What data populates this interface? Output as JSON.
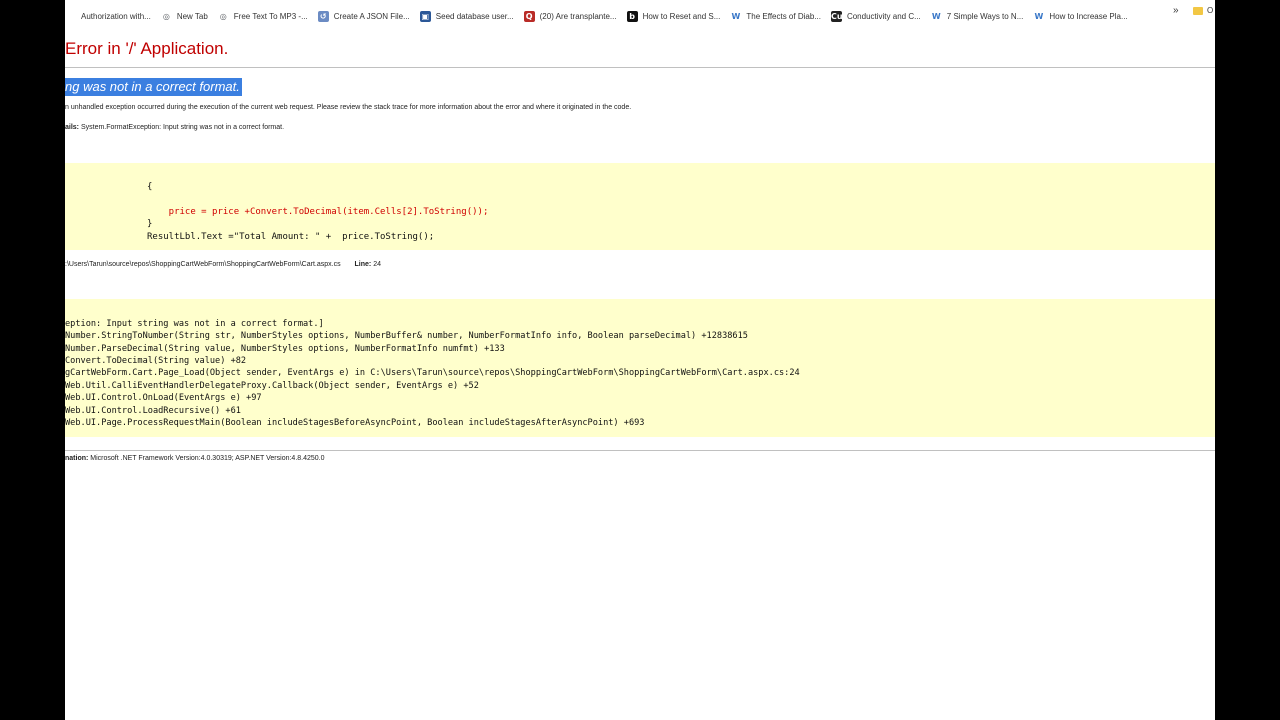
{
  "bookmarks": [
    {
      "label": "Authorization with...",
      "icon": "document-icon",
      "color": "#999999",
      "glyph": ""
    },
    {
      "label": "New Tab",
      "icon": "globe-icon",
      "color": "#5f6368",
      "glyph": "◎"
    },
    {
      "label": "Free Text To MP3 -...",
      "icon": "globe-icon",
      "color": "#5f6368",
      "glyph": "◎"
    },
    {
      "label": "Create A JSON File...",
      "icon": "document-icon",
      "color": "#6b8bc3",
      "glyph": "↺"
    },
    {
      "label": "Seed database user...",
      "icon": "db-icon",
      "color": "#2b5797",
      "glyph": "▣"
    },
    {
      "label": "(20) Are transplante...",
      "icon": "quora-icon",
      "color": "#b92b27",
      "glyph": "Q"
    },
    {
      "label": "How to Reset and S...",
      "icon": "b-logo-icon",
      "color": "#111111",
      "glyph": "b"
    },
    {
      "label": "The Effects of Diab...",
      "icon": "ivy-icon",
      "color": "#3a78c8",
      "glyph": "W"
    },
    {
      "label": "Conductivity and C...",
      "icon": "cu-icon",
      "color": "#222222",
      "glyph": "Cu"
    },
    {
      "label": "7 Simple Ways to N...",
      "icon": "ivy-icon",
      "color": "#3a78c8",
      "glyph": "W"
    },
    {
      "label": "How to Increase Pla...",
      "icon": "ivy-icon",
      "color": "#3a78c8",
      "glyph": "W"
    }
  ],
  "bookmarks_more": "»",
  "bookmarks_folder": "O",
  "error": {
    "title": "Error in '/' Application.",
    "subtitle": "ng was not in a correct format.",
    "description": "n unhandled exception occurred during the execution of the current web request. Please review the stack trace for more information about the error and where it originated in the code.",
    "details_label": "ails:",
    "details_text": "System.FormatException: Input string was not in a correct format."
  },
  "source_code": [
    {
      "text": "{",
      "red": false
    },
    {
      "text": "    price = price +Convert.ToDecimal(item.Cells[2].ToString());",
      "red": true
    },
    {
      "text": "}",
      "red": false
    },
    {
      "text": "ResultLbl.Text =\"Total Amount: \" +  price.ToString();",
      "red": false
    }
  ],
  "source_file": {
    "path": ":\\Users\\Tarun\\source\\repos\\ShoppingCartWebForm\\ShoppingCartWebForm\\Cart.aspx.cs",
    "line_label": "Line:",
    "line_number": "24"
  },
  "stack_trace": [
    "eption: Input string was not in a correct format.]",
    "Number.StringToNumber(String str, NumberStyles options, NumberBuffer& number, NumberFormatInfo info, Boolean parseDecimal) +12838615",
    "Number.ParseDecimal(String value, NumberStyles options, NumberFormatInfo numfmt) +133",
    "Convert.ToDecimal(String value) +82",
    "gCartWebForm.Cart.Page_Load(Object sender, EventArgs e) in C:\\Users\\Tarun\\source\\repos\\ShoppingCartWebForm\\ShoppingCartWebForm\\Cart.aspx.cs:24",
    "Web.Util.CalliEventHandlerDelegateProxy.Callback(Object sender, EventArgs e) +52",
    "Web.UI.Control.OnLoad(EventArgs e) +97",
    "Web.UI.Control.LoadRecursive() +61",
    "Web.UI.Page.ProcessRequestMain(Boolean includeStagesBeforeAsyncPoint, Boolean includeStagesAfterAsyncPoint) +693"
  ],
  "version": {
    "label": "nation:",
    "text": "Microsoft .NET Framework Version:4.0.30319; ASP.NET Version:4.8.4250.0"
  }
}
